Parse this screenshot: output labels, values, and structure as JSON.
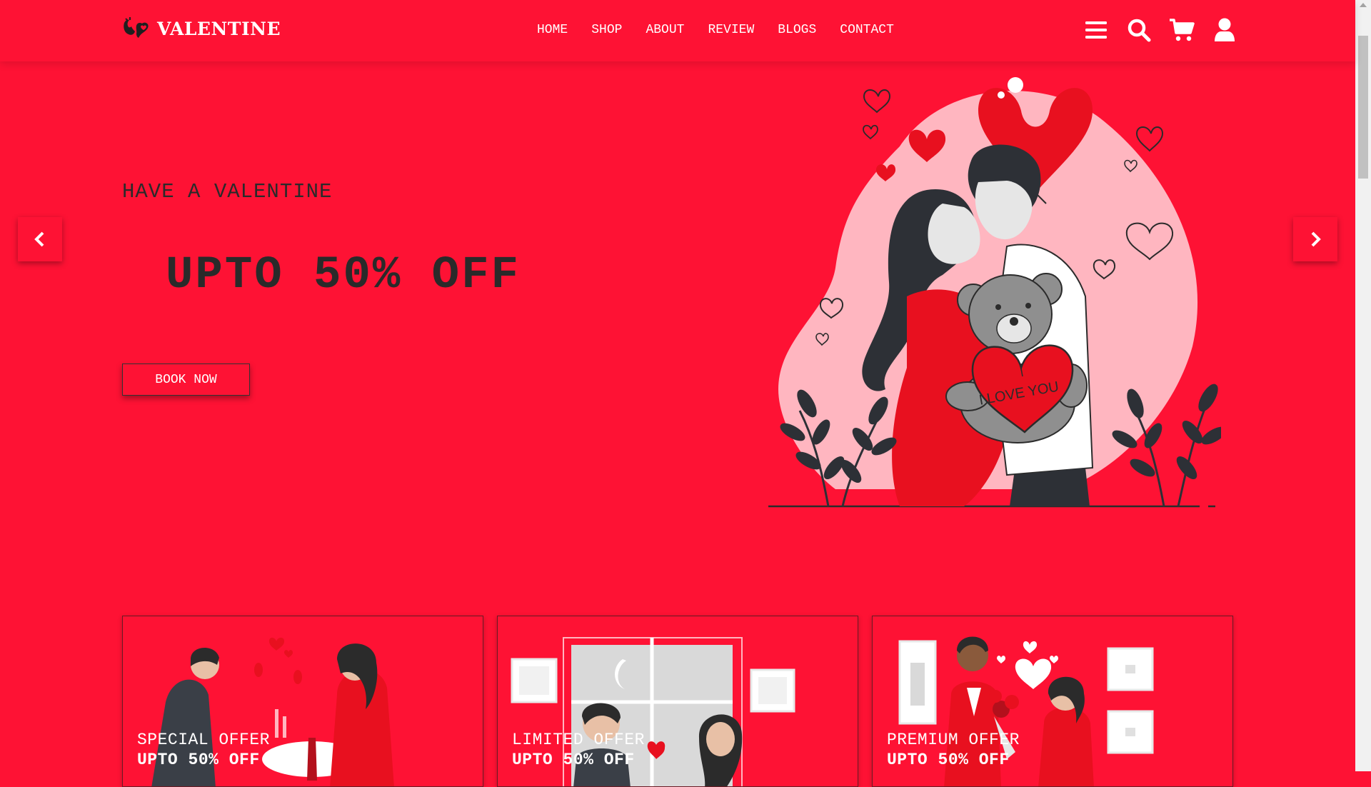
{
  "brand": {
    "name": "VALENTINE",
    "icon": "hands-heart-icon"
  },
  "nav": {
    "items": [
      {
        "label": "HOME"
      },
      {
        "label": "SHOP"
      },
      {
        "label": "ABOUT"
      },
      {
        "label": "REVIEW"
      },
      {
        "label": "BLOGS"
      },
      {
        "label": "CONTACT"
      }
    ]
  },
  "header_icons": [
    "menu-icon",
    "search-icon",
    "cart-icon",
    "user-icon"
  ],
  "hero": {
    "subtitle": "HAVE A VALENTINE",
    "title": "UPTO 50% OFF",
    "button": "BOOK NOW",
    "illustration": {
      "heart_text": "I LOVE YOU"
    }
  },
  "slider": {
    "prev_icon": "chevron-left-icon",
    "next_icon": "chevron-right-icon"
  },
  "offers": [
    {
      "label": "SPECIAL OFFER",
      "price": "UPTO 50% OFF"
    },
    {
      "label": "LIMITED OFFER",
      "price": "UPTO 50% OFF"
    },
    {
      "label": "PREMIUM OFFER",
      "price": "UPTO 50% OFF"
    }
  ],
  "colors": {
    "accent": "#fe1234",
    "text_dark": "#2a2a2a",
    "white": "#ffffff"
  }
}
